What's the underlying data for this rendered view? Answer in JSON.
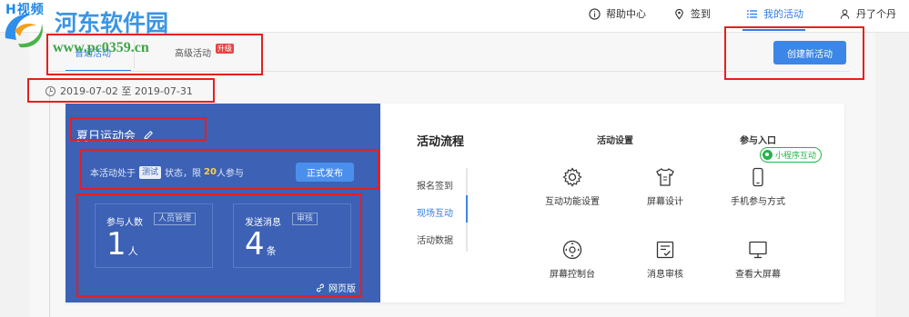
{
  "watermark": {
    "top_text": "H视频",
    "site_name": "河东软件园",
    "site_url": "www.pc0359.cn"
  },
  "nav": {
    "help": "帮助中心",
    "checkin": "签到",
    "my_activity": "我的活动",
    "user": "丹了个丹"
  },
  "tabs": {
    "basic": "普通活动",
    "advanced": "高级活动",
    "upgrade_badge": "升级"
  },
  "create_button": "创建新活动",
  "date_range": "2019-07-02 至 2019-07-31",
  "activity": {
    "title": "夏日运动会",
    "status_prefix": "本活动处于",
    "status_tag": "测试",
    "status_middle": "状态，限",
    "limit": "20",
    "status_suffix": "人参与",
    "publish_button": "正式发布",
    "participants_label": "参与人数",
    "participants_tag": "人员管理",
    "participants_value": "1",
    "participants_unit": "人",
    "messages_label": "发送消息",
    "messages_tag": "审核",
    "messages_value": "4",
    "messages_unit": "条",
    "web_link": "网页版"
  },
  "flow": {
    "title": "活动流程",
    "items": [
      "报名签到",
      "现场互动",
      "活动数据"
    ]
  },
  "columns": {
    "settings": "活动设置",
    "entry": "参与入口"
  },
  "features": {
    "interaction_settings": "互动功能设置",
    "screen_design": "屏幕设计",
    "mobile_join": "手机参与方式",
    "screen_console": "屏幕控制台",
    "message_review": "消息审核",
    "big_screen": "查看大屏幕"
  },
  "mini_program_badge": "小程序互动"
}
